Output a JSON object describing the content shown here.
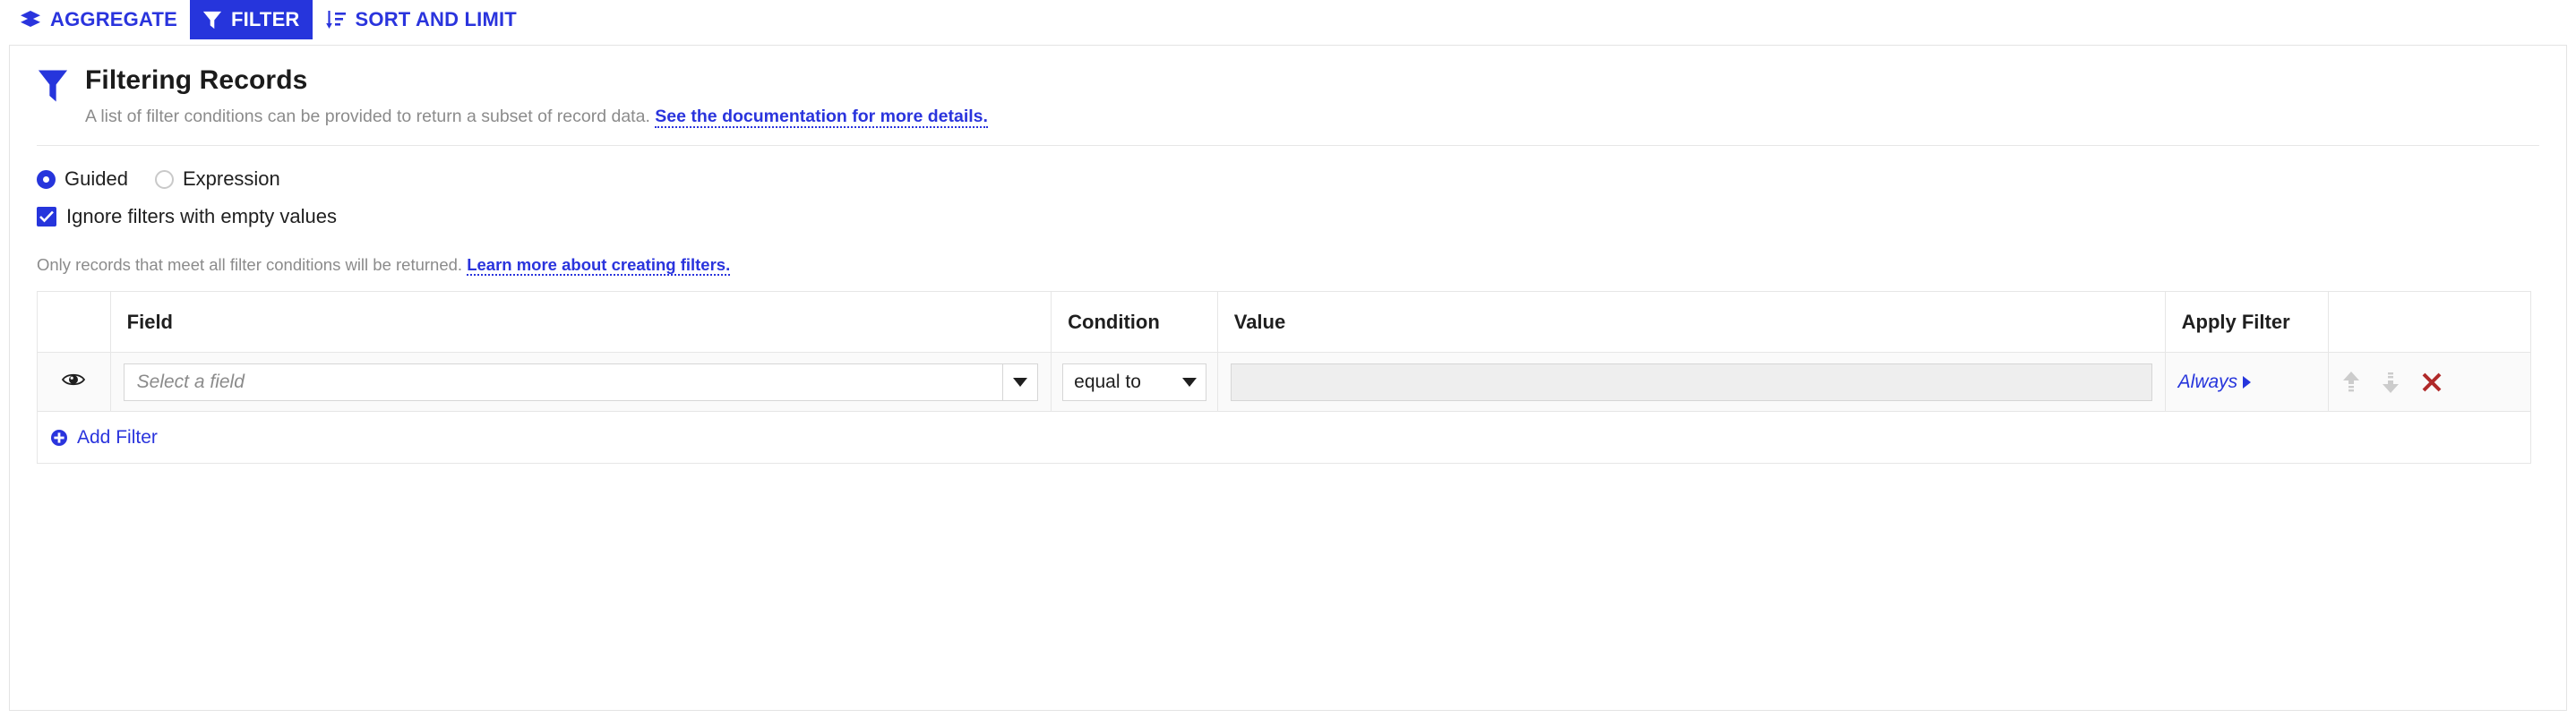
{
  "tabs": [
    {
      "label": "AGGREGATE",
      "icon": "layers-icon",
      "active": false
    },
    {
      "label": "FILTER",
      "icon": "funnel-icon",
      "active": true
    },
    {
      "label": "SORT AND LIMIT",
      "icon": "sort-descending-icon",
      "active": false
    }
  ],
  "panel": {
    "icon": "funnel-icon",
    "title": "Filtering Records",
    "description": "A list of filter conditions can be provided to return a subset of record data.",
    "description_link": "See the documentation for more details."
  },
  "options": {
    "mode_guided": "Guided",
    "mode_expression": "Expression",
    "selected_mode": "Guided",
    "ignore_empty_label": "Ignore filters with empty values",
    "ignore_empty_checked": true
  },
  "helper": {
    "text": "Only records that meet all filter conditions will be returned.",
    "link": "Learn more about creating filters."
  },
  "table": {
    "headers": {
      "eye": "",
      "field": "Field",
      "condition": "Condition",
      "value": "Value",
      "apply": "Apply Filter",
      "actions": ""
    },
    "rows": [
      {
        "visibility_icon": "eye-icon",
        "field_placeholder": "Select a field",
        "field_value": "",
        "condition_value": "equal to",
        "value_value": "",
        "value_disabled": true,
        "apply_label": "Always",
        "actions": [
          "move-up-icon",
          "move-down-icon",
          "delete-icon"
        ]
      }
    ],
    "add_filter_label": "Add Filter"
  },
  "colors": {
    "accent": "#2635dc",
    "link": "#2a34dd",
    "muted": "#8b8b8b",
    "delete": "#b02a2a",
    "disabled_field": "#eeeeee",
    "row_bg": "#fafafa"
  }
}
